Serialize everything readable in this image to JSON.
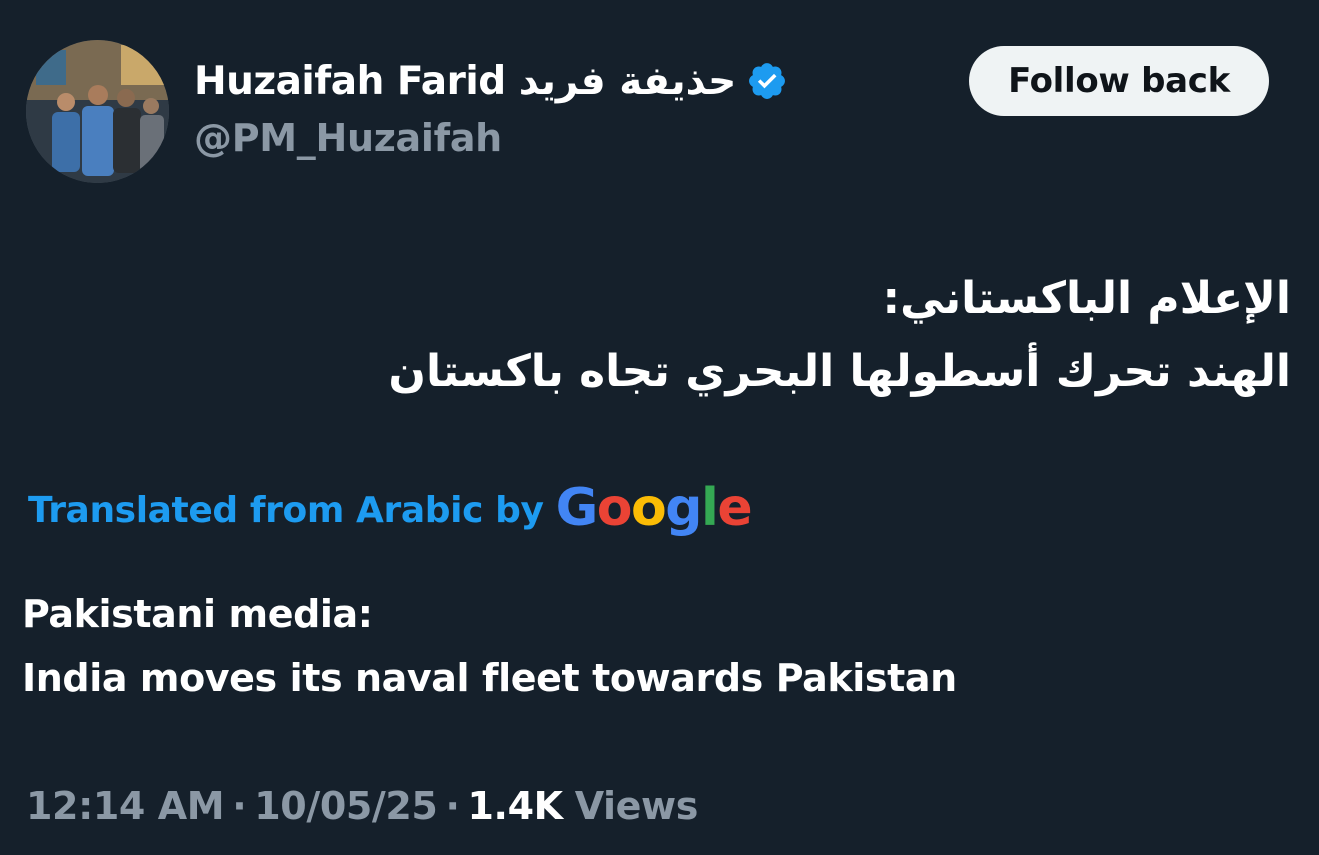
{
  "author": {
    "display_name": "Huzaifah Farid حذيفة فريد",
    "handle": "@PM_Huzaifah",
    "verified_icon": "verified-badge-icon",
    "verified_color": "#1d9bf0"
  },
  "follow_button": {
    "label": "Follow back"
  },
  "tweet": {
    "original_lines": [
      "الإعلام الباكستاني:",
      "الهند تحرك أسطولها البحري تجاه باكستان"
    ],
    "translation_label": "Translated from Arabic by",
    "translation_provider": "Google",
    "translated_lines": [
      "Pakistani media:",
      "India moves its naval fleet towards Pakistan"
    ]
  },
  "meta": {
    "time": "12:14 AM",
    "separator": "·",
    "date": "10/05/25",
    "views_count": "1.4K",
    "views_label": "Views"
  },
  "colors": {
    "background": "#15202b",
    "accent": "#1d9bf0",
    "secondary_text": "#8b98a5",
    "button_bg": "#eff3f4"
  }
}
